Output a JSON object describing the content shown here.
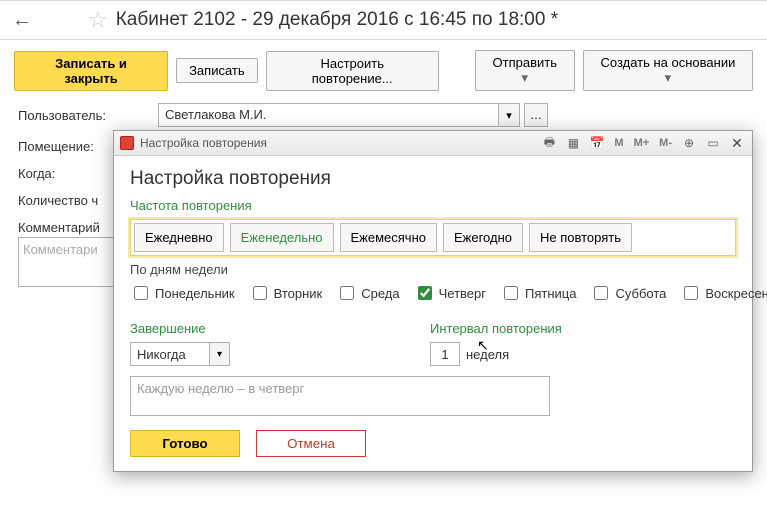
{
  "title": "Кабинет 2102 - 29 декабря 2016 с 16:45 по 18:00 *",
  "toolbar": {
    "save_close": "Записать и закрыть",
    "save": "Записать",
    "repeat_setup": "Настроить повторение...",
    "send": "Отправить",
    "create_based": "Создать на основании"
  },
  "labels": {
    "user": "Пользователь:",
    "room": "Помещение:",
    "when": "Когда:",
    "count": "Количество ч",
    "comment": "Комментарий"
  },
  "user_value": "Светлакова М.И.",
  "comment_placeholder": "Комментари",
  "modal": {
    "window_title": "Настройка повторения",
    "heading": "Настройка повторения",
    "freq_heading": "Частота повторения",
    "freq": {
      "daily": "Ежедневно",
      "weekly": "Еженедельно",
      "monthly": "Ежемесячно",
      "yearly": "Ежегодно",
      "never": "Не повторять"
    },
    "days_heading": "По дням недели",
    "days": {
      "mon": "Понедельник",
      "tue": "Вторник",
      "wed": "Среда",
      "thu": "Четверг",
      "fri": "Пятница",
      "sat": "Суббота",
      "sun": "Воскресенье"
    },
    "end_heading": "Завершение",
    "end_value": "Никогда",
    "interval_heading": "Интервал повторения",
    "interval_value": "1",
    "interval_unit": "неделя",
    "summary": "Каждую неделю – в четверг",
    "ok": "Готово",
    "cancel": "Отмена",
    "tb": {
      "m": "M",
      "mplus": "M+",
      "mminus": "M-"
    }
  }
}
